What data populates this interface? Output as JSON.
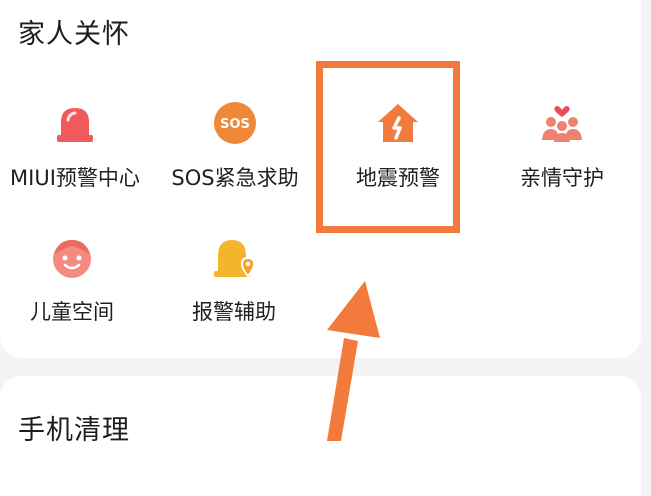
{
  "section_family": {
    "title": "家人关怀",
    "items": [
      {
        "label": "MIUI预警中心",
        "icon": "alarm-siren-icon"
      },
      {
        "label": "SOS紧急求助",
        "icon": "sos-icon"
      },
      {
        "label": "地震预警",
        "icon": "earthquake-house-icon"
      },
      {
        "label": "亲情守护",
        "icon": "family-care-icon"
      },
      {
        "label": "儿童空间",
        "icon": "child-face-icon"
      },
      {
        "label": "报警辅助",
        "icon": "alarm-bell-location-icon"
      }
    ]
  },
  "section_cleanup": {
    "title": "手机清理"
  },
  "colors": {
    "accent_orange": "#f27a3d",
    "siren_red": "#f05a5a",
    "sos_orange": "#f0883a",
    "family_pink": "#f08070",
    "bell_yellow": "#f5b52a"
  }
}
